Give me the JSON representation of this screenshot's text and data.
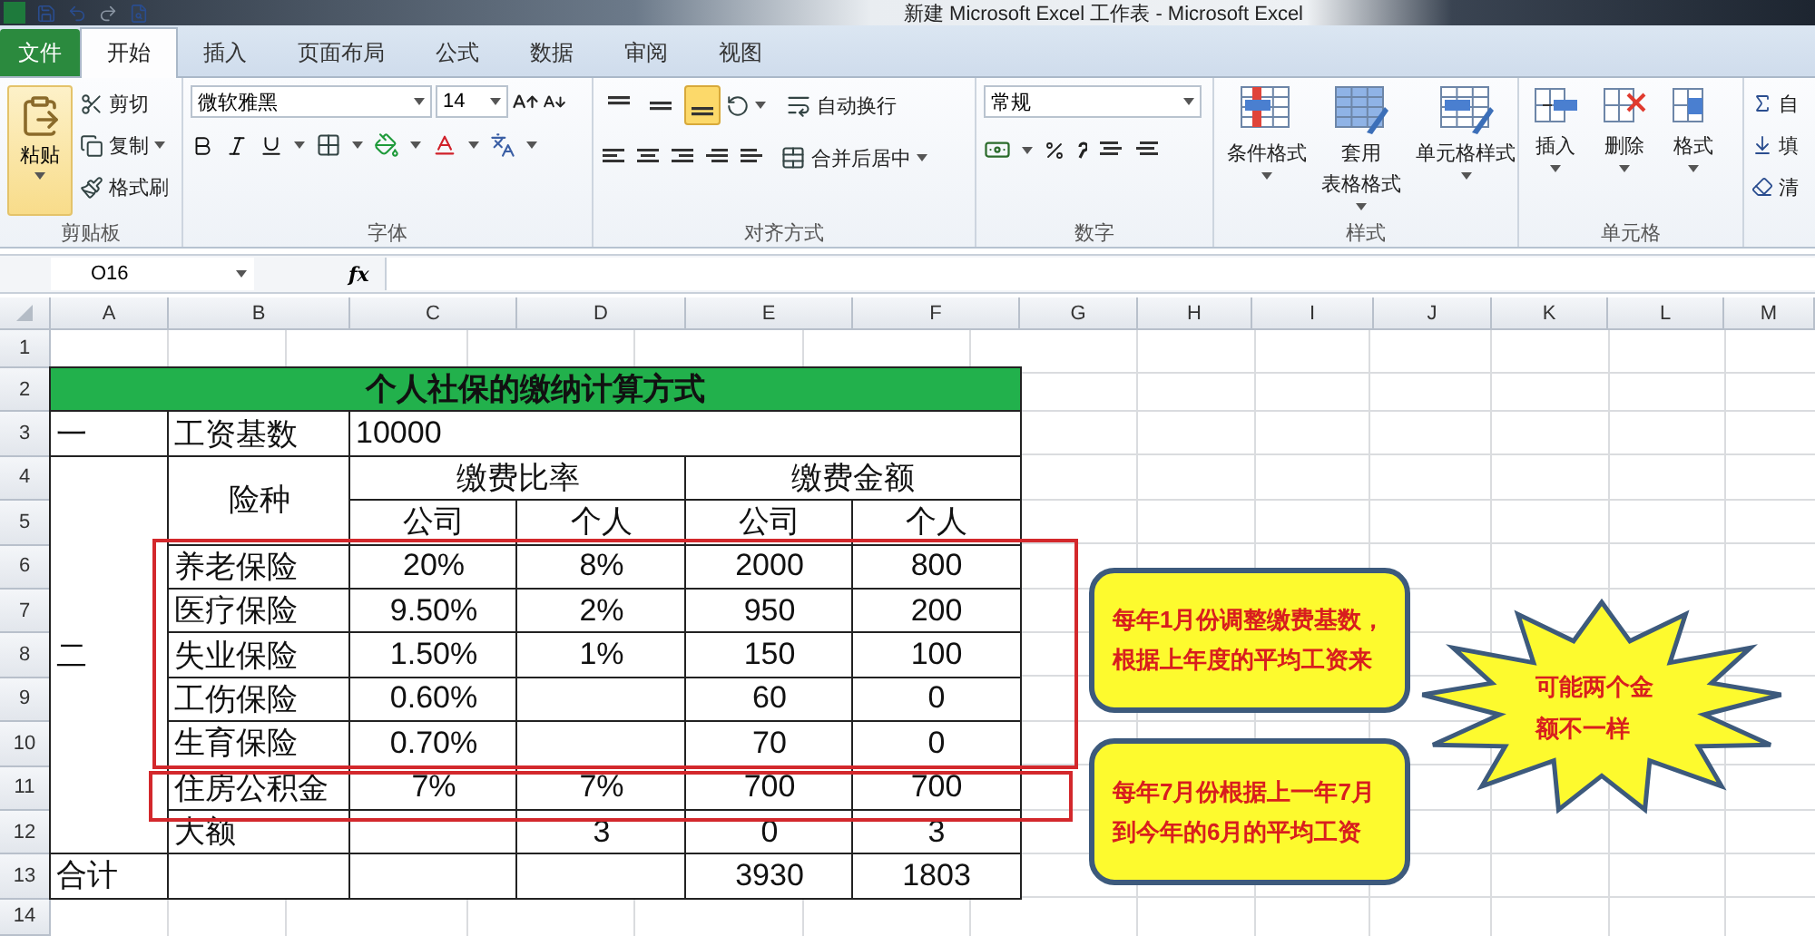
{
  "window": {
    "title": "新建 Microsoft Excel 工作表 - Microsoft Excel"
  },
  "tabs": [
    {
      "label": "文件",
      "kind": "file",
      "selected": false
    },
    {
      "label": "开始",
      "kind": "tab",
      "selected": true
    },
    {
      "label": "插入",
      "kind": "tab",
      "selected": false
    },
    {
      "label": "页面布局",
      "kind": "tab",
      "selected": false
    },
    {
      "label": "公式",
      "kind": "tab",
      "selected": false
    },
    {
      "label": "数据",
      "kind": "tab",
      "selected": false
    },
    {
      "label": "审阅",
      "kind": "tab",
      "selected": false
    },
    {
      "label": "视图",
      "kind": "tab",
      "selected": false
    }
  ],
  "ribbon": {
    "clipboard": {
      "label": "剪贴板",
      "paste": "粘贴",
      "actions": [
        "剪切",
        "复制",
        "格式刷"
      ]
    },
    "font": {
      "label": "字体",
      "font_name": "微软雅黑",
      "font_size": "14"
    },
    "alignment": {
      "label": "对齐方式",
      "vertical": [
        {
          "selected": false
        },
        {
          "selected": false
        },
        {
          "selected": true
        }
      ],
      "wrap": "自动换行",
      "merge": "合并后居中"
    },
    "number": {
      "label": "数字",
      "format": "常规"
    },
    "styles": {
      "label": "样式",
      "buttons": [
        {
          "lines": [
            "条件格式"
          ]
        },
        {
          "lines": [
            "套用",
            "表格格式"
          ]
        },
        {
          "lines": [
            "单元格样式"
          ]
        }
      ]
    },
    "cells": {
      "label": "单元格",
      "buttons": [
        "插入",
        "删除",
        "格式"
      ]
    },
    "editing": {
      "buttons": [
        "自",
        "填",
        "清"
      ]
    }
  },
  "formula_bar": {
    "name_box": "O16",
    "function_button": "fx"
  },
  "columns": [
    "A",
    "B",
    "C",
    "D",
    "E",
    "F",
    "G",
    "H",
    "I",
    "J",
    "K",
    "L",
    "M"
  ],
  "rows": [
    "1",
    "2",
    "3",
    "4",
    "5",
    "6",
    "7",
    "8",
    "9",
    "10",
    "11",
    "12",
    "13",
    "14"
  ],
  "sheet": {
    "title": "个人社保的缴纳计算方式",
    "base": {
      "section": "一",
      "label": "工资基数",
      "value": "10000"
    },
    "section": "二",
    "type_header": "险种",
    "groups": [
      {
        "label": "缴费比率",
        "sub": [
          "公司",
          "个人"
        ]
      },
      {
        "label": "缴费金额",
        "sub": [
          "公司",
          "个人"
        ]
      }
    ],
    "items": [
      {
        "name": "养老保险",
        "company_rate": "20%",
        "personal_rate": "8%",
        "company_amount": "2000",
        "personal_amount": "800"
      },
      {
        "name": "医疗保险",
        "company_rate": "9.50%",
        "personal_rate": "2%",
        "company_amount": "950",
        "personal_amount": "200"
      },
      {
        "name": "失业保险",
        "company_rate": "1.50%",
        "personal_rate": "1%",
        "company_amount": "150",
        "personal_amount": "100"
      },
      {
        "name": "工伤保险",
        "company_rate": "0.60%",
        "company_amount": "60",
        "personal_amount": "0"
      },
      {
        "name": "生育保险",
        "company_rate": "0.70%",
        "company_amount": "70",
        "personal_amount": "0"
      },
      {
        "name": "住房公积金",
        "company_rate": "7%",
        "personal_rate": "7%",
        "company_amount": "700",
        "personal_amount": "700"
      },
      {
        "name": "大额",
        "personal_rate": "3",
        "company_amount": "0",
        "personal_amount": "3"
      }
    ],
    "total": {
      "label": "合计",
      "company_amount": "3930",
      "personal_amount": "1803"
    }
  },
  "notes": [
    {
      "kind": "box",
      "lines": [
        "每年1月份调整缴费基数，",
        "根据上年度的平均工资来"
      ]
    },
    {
      "kind": "box",
      "lines": [
        "每年7月份根据上一年7月",
        "到今年的6月的平均工资"
      ]
    },
    {
      "kind": "star",
      "lines": [
        "可能两个金",
        "额不一样"
      ]
    }
  ]
}
